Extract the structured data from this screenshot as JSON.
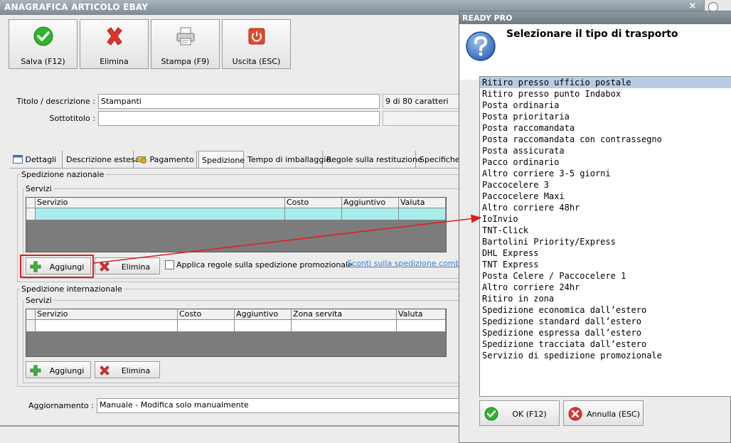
{
  "main": {
    "title": "ANAGRAFICA ARTICOLO EBAY",
    "close_glyph": "×",
    "toolbar": {
      "save": {
        "label": "Salva (F12)",
        "icon": "check-icon"
      },
      "delete": {
        "label": "Elimina",
        "icon": "red-x-icon"
      },
      "print": {
        "label": "Stampa (F9)",
        "icon": "printer-icon"
      },
      "exit": {
        "label": "Uscita (ESC)",
        "icon": "power-icon"
      }
    },
    "title_label": "Titolo / descrizione :",
    "title_value": "Stampanti",
    "title_counter": "9 di 80 caratteri",
    "subtitle_label": "Sottotitolo :",
    "subtitle_value": "",
    "tabs": [
      {
        "label": "Dettagli",
        "icon": "calendar-icon"
      },
      {
        "label": "Descrizione estesa"
      },
      {
        "label": "Pagamento",
        "icon": "money-icon"
      },
      {
        "label": "Spedizione",
        "active": true
      },
      {
        "label": "Tempo di imballaggio"
      },
      {
        "label": "Regole sulla restituzione"
      },
      {
        "label": "Specifiche"
      }
    ],
    "national": {
      "group_title": "Spedizione nazionale",
      "services_title": "Servizi",
      "columns": [
        "Servizio",
        "Costo",
        "Aggiuntivo",
        "Valuta"
      ],
      "add_label": "Aggiungi",
      "delete_label": "Elimina",
      "promo_checkbox_label": "Applica regole sulla spedizione promozionale",
      "promo_checked": false,
      "combined_discount_link": "Sconti sulla spedizione combinata"
    },
    "international": {
      "group_title": "Spedizione internazionale",
      "services_title": "Servizi",
      "columns": [
        "Servizio",
        "Costo",
        "Aggiuntivo",
        "Zona servita",
        "Valuta"
      ],
      "add_label": "Aggiungi",
      "delete_label": "Elimina"
    },
    "update_label": "Aggiornamento :",
    "update_value": "Manuale - Modifica solo manualmente"
  },
  "dialog": {
    "title": "READY PRO",
    "header": "Selezionare il tipo di trasporto",
    "icon": "question-icon",
    "items": [
      "Ritiro presso ufficio postale",
      "Ritiro presso punto Indabox",
      "Posta ordinaria",
      "Posta prioritaria",
      "Posta raccomandata",
      "Posta raccomandata con contrassegno",
      "Posta assicurata",
      "Pacco ordinario",
      "Altro corriere 3-5 giorni",
      "Paccocelere 3",
      "Paccocelere Maxi",
      "Altro corriere 48hr",
      "IoInvio",
      "TNT-Click",
      "Bartolini Priority/Express",
      "DHL Express",
      "TNT Express",
      "Posta Celere / Paccocelere 1",
      "Altro corriere 24hr",
      "Ritiro in zona",
      "Spedizione economica dall’estero",
      "Spedizione standard dall’estero",
      "Spedizione espressa dall’estero",
      "Spedizione tracciata dall’estero",
      "Servizio di spedizione promozionale"
    ],
    "selected_index": 0,
    "ok_label": "OK (F12)",
    "cancel_label": "Annulla (ESC)"
  },
  "colors": {
    "annotation": "#e01c1c",
    "selection": "#b7cce4",
    "grid_row": "#a8ecec",
    "link": "#3b7fc4"
  }
}
